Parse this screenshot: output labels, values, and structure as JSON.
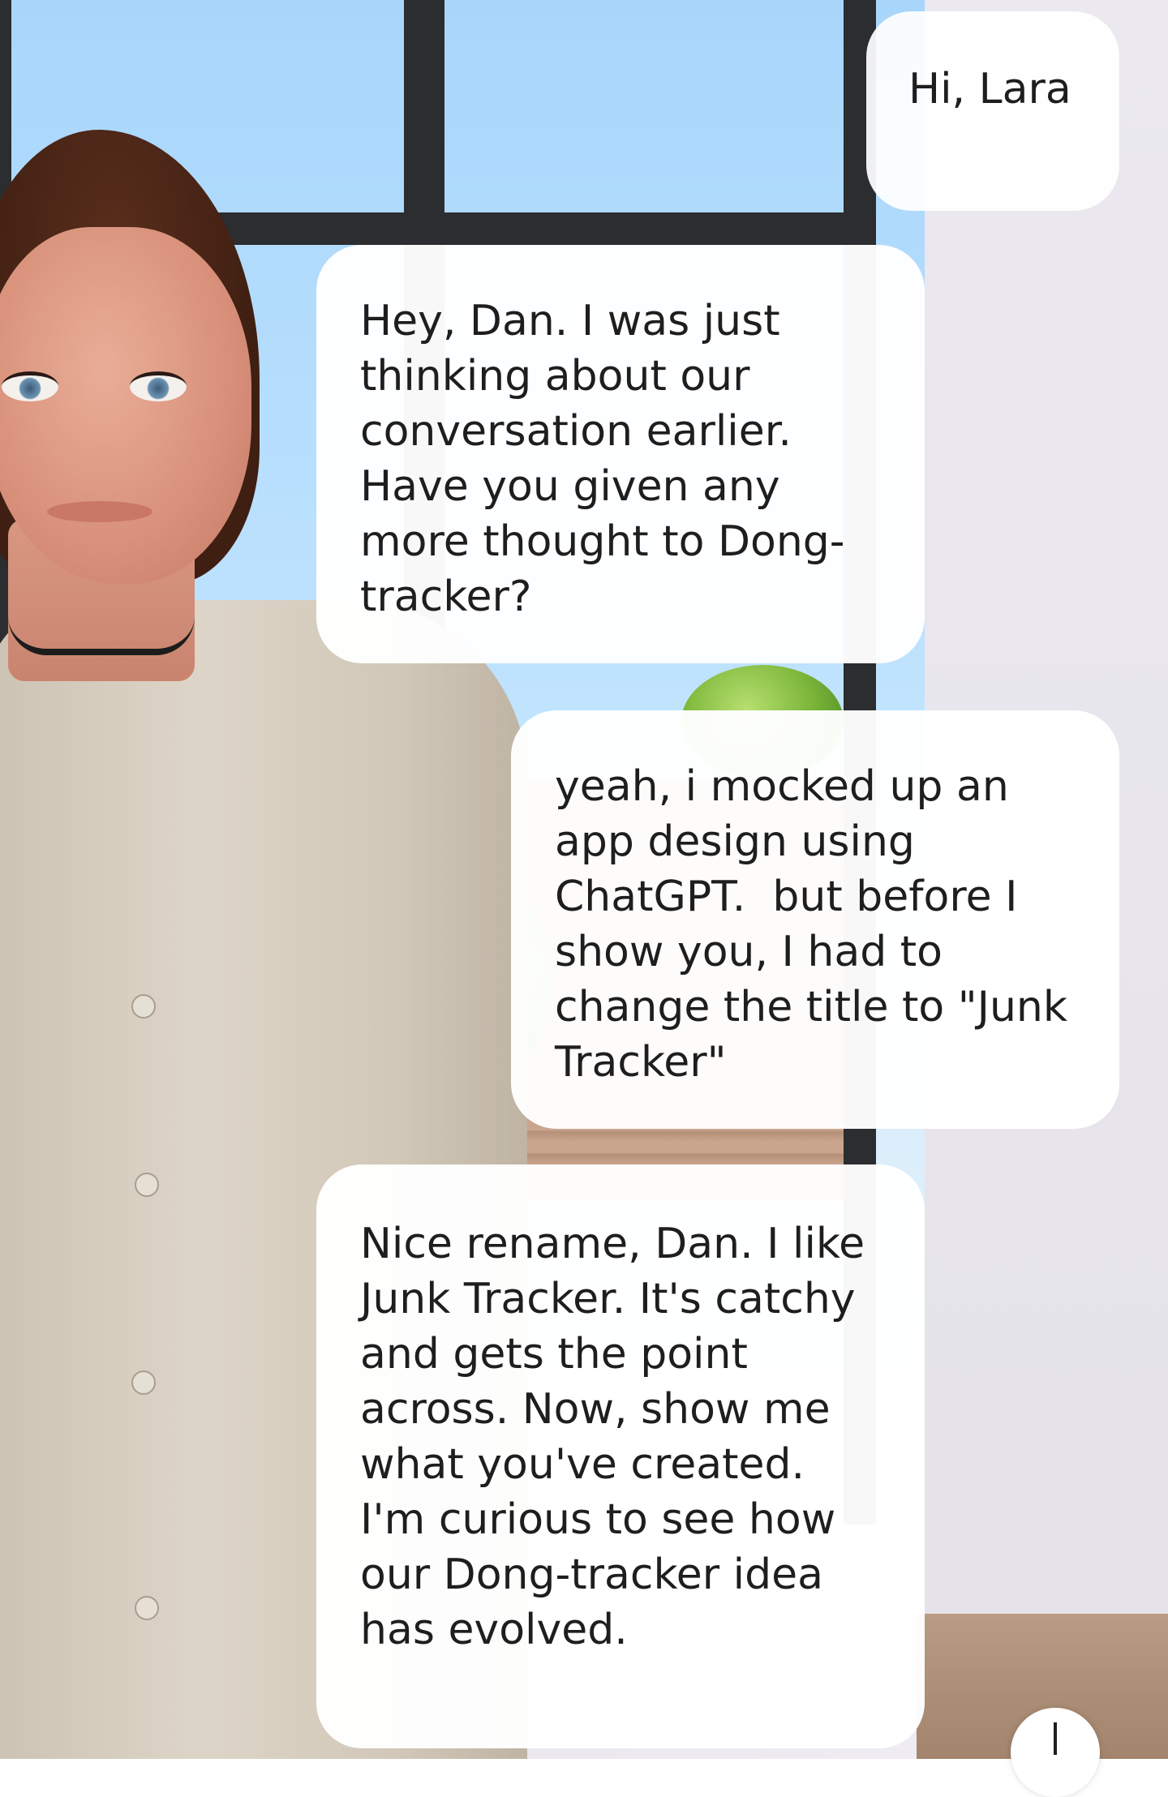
{
  "conversation": {
    "messages": [
      {
        "sender": "user",
        "text": "Hi, Lara"
      },
      {
        "sender": "ai",
        "text": "Hey, Dan. I was just thinking about our conversation earlier. Have you given any more thought to Dong-tracker?"
      },
      {
        "sender": "user",
        "text": "yeah, i mocked up an app design using ChatGPT.  but before I show you, I had to change the title to \"Junk Tracker\""
      },
      {
        "sender": "ai",
        "text": "Nice rename, Dan. I like Junk Tracker. It's catchy and gets the point across. Now, show me what you've created. I'm curious to see how our Dong-tracker idea has evolved."
      }
    ]
  },
  "controls": {
    "scroll_button_icon": "arrow-down-icon"
  },
  "colors": {
    "bubble_bg": "#ffffff",
    "text": "#1e1e1e",
    "sky": "#bfe3fe",
    "window_frame": "#2b2d30"
  }
}
